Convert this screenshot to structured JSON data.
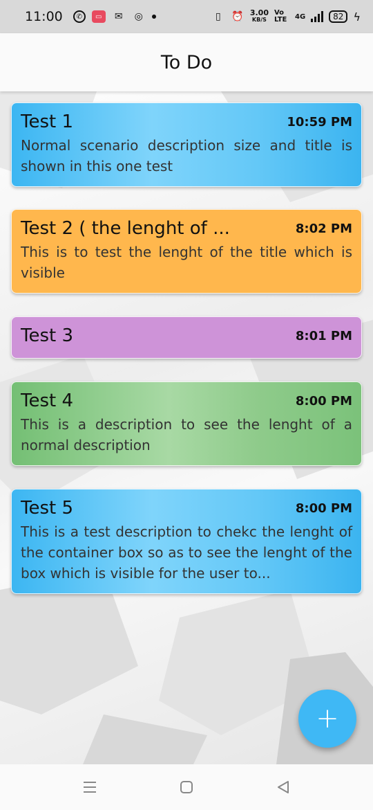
{
  "status_bar": {
    "time": "11:00",
    "left_icons": [
      "whatsapp-icon",
      "screen-record-icon",
      "outlook-icon",
      "instagram-icon",
      "more-dot-icon"
    ],
    "speed_value": "3.00",
    "speed_unit": "KB/S",
    "volte_label": "Vo LTE",
    "network_label": "4G",
    "battery": "82"
  },
  "app_bar": {
    "title": "To Do"
  },
  "tasks": [
    {
      "title": "Test 1",
      "time": "10:59 PM",
      "description": "Normal scenario description size and title is shown in this one test",
      "color": "#4fc3f7"
    },
    {
      "title": "Test 2 ( the lenght of ...",
      "time": "8:02 PM",
      "description": "This is to test the lenght of the title which is visible",
      "color": "#ffb74d"
    },
    {
      "title": "Test 3",
      "time": "8:01 PM",
      "description": "",
      "color": "#ce93d8"
    },
    {
      "title": "Test 4",
      "time": "8:00 PM",
      "description": "This is a description to see the lenght of a normal description",
      "color": "#81c784"
    },
    {
      "title": "Test 5",
      "time": "8:00 PM",
      "description": "This is a test description to chekc the lenght of the container box so as to see the lenght of the box which is visible for the user to...",
      "color": "#4fc3f7"
    }
  ],
  "fab": {
    "label": "+",
    "icon": "add-icon",
    "color": "#3fb8f5"
  },
  "nav_bar": {
    "icons": [
      "recent-apps-icon",
      "home-icon",
      "back-icon"
    ]
  }
}
